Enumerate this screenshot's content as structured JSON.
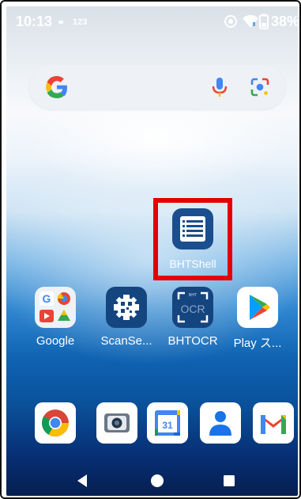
{
  "status_bar": {
    "time": "10:13",
    "small_indicator": "123",
    "battery_percent": "38%",
    "icons": [
      "notification-dot-icon",
      "signal-wifi-icon",
      "battery-icon"
    ]
  },
  "search_widget": {
    "g_logo": "G",
    "icons": [
      "google-g-icon",
      "mic-icon",
      "lens-icon"
    ]
  },
  "home": {
    "highlighted_app": {
      "label": "BHTShell",
      "icon": "list-icon",
      "highlight_color": "#e40000"
    },
    "apps": [
      {
        "label": "Google",
        "icon": "google-folder-icon"
      },
      {
        "label": "ScanSe...",
        "icon": "qr-gear-icon"
      },
      {
        "label": "BHTOCR",
        "icon": "ocr-icon"
      },
      {
        "label": "Play ス...",
        "icon": "play-store-icon"
      }
    ]
  },
  "dock": {
    "apps": [
      {
        "name": "Chrome",
        "icon": "chrome-icon"
      },
      {
        "name": "Camera",
        "icon": "camera-icon"
      },
      {
        "name": "Calendar",
        "icon": "calendar-icon",
        "calendar_text": "31"
      },
      {
        "name": "Contacts",
        "icon": "contacts-icon"
      },
      {
        "name": "Gmail",
        "icon": "gmail-icon"
      }
    ]
  },
  "nav_bar": {
    "icons": [
      "back-icon",
      "home-icon",
      "recents-icon"
    ]
  },
  "colors": {
    "accent_red": "#e40000",
    "google_blue": "#4285F4",
    "google_red": "#EA4335",
    "google_yellow": "#FBBC05",
    "google_green": "#34A853"
  }
}
